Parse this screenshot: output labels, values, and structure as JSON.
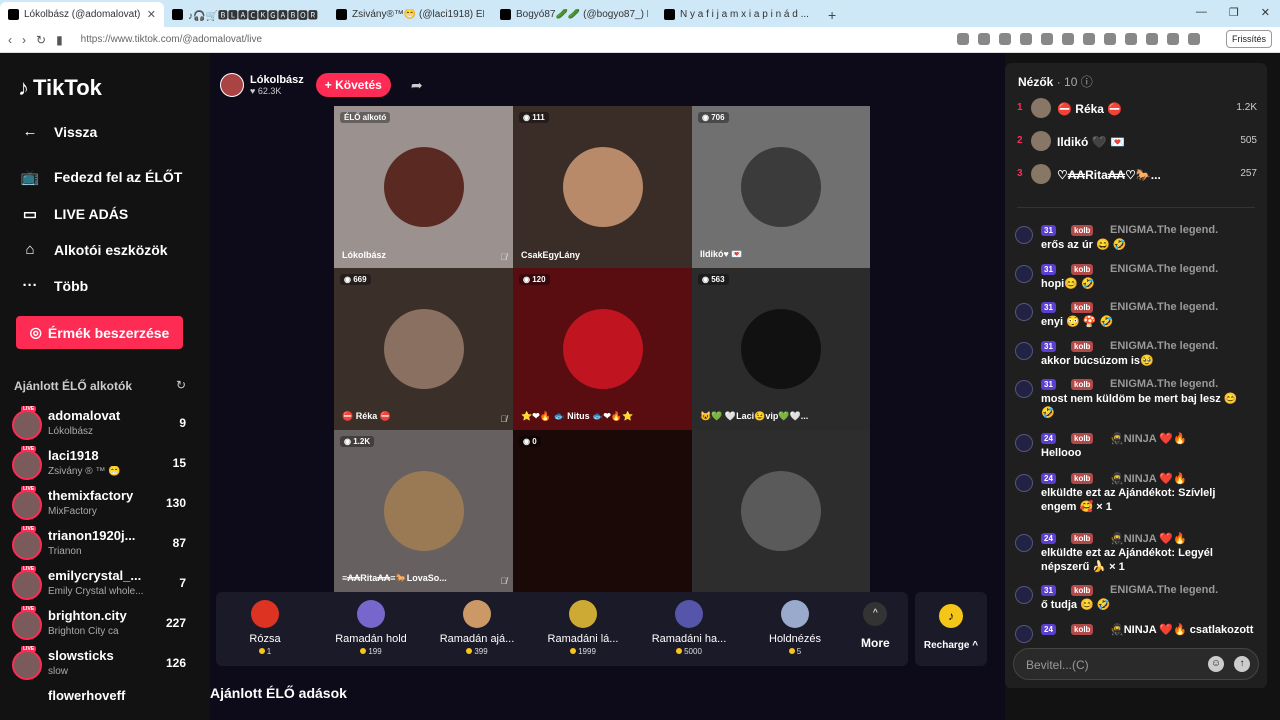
{
  "browser": {
    "tabs": [
      {
        "title": "Lókolbász (@adomalovat) Él..."
      },
      {
        "title": "♪🎧🛒🅱🅻🅰🅲🅺🅶🅰🅱🅾🆁 (@gabor..."
      },
      {
        "title": "Zsivány®™😁 (@laci1918) ÉLŐ adás"
      },
      {
        "title": "Bogyó87🥒🥒 (@bogyo87_) ÉLŐ a..."
      },
      {
        "title": "N y a f i j a m x i a p i n á d ..."
      }
    ],
    "url": "https://www.tiktok.com/@adomalovat/live",
    "refresh_label": "Frissítés"
  },
  "sidebar": {
    "logo": "TikTok",
    "nav": [
      {
        "label": "Vissza",
        "icon": "back-arrow-icon"
      },
      {
        "label": "Fedezd fel az ÉLŐT",
        "icon": "live-tv-icon"
      },
      {
        "label": "LIVE ADÁS",
        "icon": "video-camera-icon"
      },
      {
        "label": "Alkotói eszközök",
        "icon": "creator-tools-icon"
      },
      {
        "label": "Több",
        "icon": "more-dots-icon"
      }
    ],
    "coins_button": "Érmék beszerzése",
    "recommended_title": "Ajánlott ÉLŐ alkotók",
    "creators": [
      {
        "name": "adomalovat",
        "sub": "Lókolbász",
        "count": "9"
      },
      {
        "name": "laci1918",
        "sub": "Zsivány ® ™ 😁",
        "count": "15"
      },
      {
        "name": "themixfactory",
        "sub": "MixFactory",
        "count": "130"
      },
      {
        "name": "trianon1920j...",
        "sub": "Trianon",
        "count": "87"
      },
      {
        "name": "emilycrystal_...",
        "sub": "Emily Crystal whole...",
        "count": "7"
      },
      {
        "name": "brighton.city",
        "sub": "Brighton City ca",
        "count": "227"
      },
      {
        "name": "slowsticks",
        "sub": "slow",
        "count": "126"
      },
      {
        "name": "flowerhoveff",
        "sub": "",
        "count": ""
      }
    ]
  },
  "host": {
    "name": "Lókolbász",
    "likes": "62.3K",
    "follow_label": "+ Követés"
  },
  "grid": [
    {
      "badge": "ÉLŐ alkotó",
      "name": "Lókolbász",
      "muted": true,
      "bg": "#9b9290",
      "av": "#5a2a22"
    },
    {
      "badge": "111",
      "name": "CsakEgyLány",
      "muted": false,
      "bg": "#3a2d28",
      "av": "#b88a6a"
    },
    {
      "badge": "706",
      "name": "Ildikó♥ 💌",
      "muted": false,
      "bg": "#707070",
      "av": "#3b3b3b"
    },
    {
      "badge": "669",
      "name": "⛔ Réka ⛔",
      "muted": true,
      "bg": "#3b2f2a",
      "av": "#8a7060"
    },
    {
      "badge": "120",
      "name": "⭐❤🔥 🐟 Nitus 🐟❤🔥⭐",
      "muted": false,
      "bg": "#5a0d10",
      "av": "#c01520"
    },
    {
      "badge": "563",
      "name": "😺💚 🤍Laci😉vip💚🤍...",
      "muted": false,
      "bg": "#2b2b2b",
      "av": "#111"
    },
    {
      "badge": "1.2K",
      "name": "≡₳₳Rita₳₳≡🐎LovaSo...",
      "muted": true,
      "bg": "#676060",
      "av": "#9a7a55"
    },
    {
      "badge": "0",
      "name": "",
      "muted": false,
      "bg": "#1a0906",
      "av": ""
    },
    {
      "badge": "",
      "name": "",
      "muted": false,
      "bg": "#2d2d2d",
      "av": "#5a5a5a"
    }
  ],
  "gifts": [
    {
      "name": "Rózsa",
      "price": "1",
      "color": "#d32"
    },
    {
      "name": "Ramadán hold",
      "price": "199",
      "color": "#76c"
    },
    {
      "name": "Ramadán ajá...",
      "price": "399",
      "color": "#c96"
    },
    {
      "name": "Ramadáni lá...",
      "price": "1999",
      "color": "#ca3"
    },
    {
      "name": "Ramadáni ha...",
      "price": "5000",
      "color": "#55a"
    },
    {
      "name": "Holdnézés",
      "price": "5",
      "color": "#9ac"
    }
  ],
  "more_label": "More",
  "recharge_label": "Recharge ^",
  "recommended_live": "Ajánlott ÉLŐ adások",
  "viewers": {
    "title": "Nézők",
    "count": "· 10",
    "top": [
      {
        "rank": "1",
        "name": "⛔ Réka ⛔",
        "score": "1.2K"
      },
      {
        "rank": "2",
        "name": "Ildikó 🖤 💌",
        "score": "505"
      },
      {
        "rank": "3",
        "name": "♡₳₳Rita₳₳♡🐎...",
        "score": "257"
      }
    ]
  },
  "chat": [
    {
      "level": "31",
      "badge": "kolb",
      "user": "ENIGMA.The legend.",
      "msg": "erős az úr 😄 🤣"
    },
    {
      "level": "31",
      "badge": "kolb",
      "user": "ENIGMA.The legend.",
      "msg": "hopi😊 🤣"
    },
    {
      "level": "31",
      "badge": "kolb",
      "user": "ENIGMA.The legend.",
      "msg": "enyi 😳 🍄 🤣"
    },
    {
      "level": "31",
      "badge": "kolb",
      "user": "ENIGMA.The legend.",
      "msg": "akkor búcsúzom is🥹"
    },
    {
      "level": "31",
      "badge": "kolb",
      "user": "ENIGMA.The legend.",
      "msg": "most nem küldöm be mert baj lesz 😊 🤣"
    },
    {
      "level": "24",
      "badge": "kolb",
      "user": "🥷NINJA ❤️🔥",
      "msg": "Hellooo"
    },
    {
      "level": "24",
      "badge": "kolb",
      "user": "🥷NINJA ❤️🔥",
      "msg": "elküldte ezt az Ajándékot: Szívlelj engem 🥰 × 1"
    },
    {
      "level": "24",
      "badge": "kolb",
      "user": "🥷NINJA ❤️🔥",
      "msg": "elküldte ezt az Ajándékot: Legyél népszerű 🍌 × 1"
    },
    {
      "level": "31",
      "badge": "kolb",
      "user": "ENIGMA.The legend.",
      "msg": "ő tudja 😊 🤣"
    },
    {
      "level": "24",
      "badge": "kolb",
      "user": "🥷NINJA ❤️🔥 csatlakozott",
      "msg": ""
    }
  ],
  "input": {
    "placeholder": "Bevitel...(C)"
  }
}
